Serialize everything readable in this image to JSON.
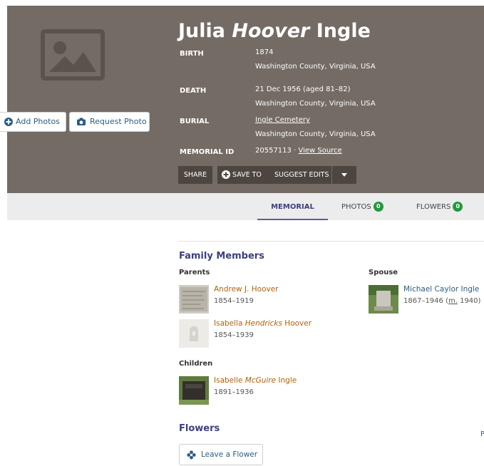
{
  "memorial": {
    "first_name": "Julia",
    "middle_name": "Hoover",
    "last_name": "Ingle",
    "birth_label": "BIRTH",
    "birth_date": "1874",
    "birth_place": "Washington County, Virginia, USA",
    "death_label": "DEATH",
    "death_date": "21 Dec 1956 (aged 81–82)",
    "death_place": "Washington County, Virginia, USA",
    "burial_label": "BURIAL",
    "burial_cemetery": "Ingle Cemetery",
    "burial_place": "Washington County, Virginia, USA",
    "memorial_id_label": "MEMORIAL ID",
    "memorial_id": "20557113",
    "id_sep": " · ",
    "view_source": "View Source"
  },
  "photo_buttons": {
    "add": "Add Photos",
    "request": "Request Photo"
  },
  "actions": {
    "share": "SHARE",
    "save_to": "SAVE TO",
    "suggest_edits": "SUGGEST EDITS"
  },
  "tabs": [
    {
      "label": "MEMORIAL"
    },
    {
      "label": "PHOTOS",
      "count": "0"
    },
    {
      "label": "FLOWERS",
      "count": "0"
    }
  ],
  "family": {
    "title": "Family Members",
    "parents_label": "Parents",
    "spouse_label": "Spouse",
    "children_label": "Children",
    "parents": [
      {
        "first": "Andrew J. Hoover",
        "dates": "1854–1919"
      },
      {
        "first": "Isabella ",
        "middle": "Hendricks",
        "last": " Hoover",
        "dates": "1854–1939"
      }
    ],
    "spouse": {
      "name": "Michael Caylor Ingle",
      "dates_pre": "1867–1946 (",
      "m": "m.",
      "dates_post": " 1940)"
    },
    "children": [
      {
        "first": "Isabelle ",
        "middle": "McGuire",
        "last": " Ingle",
        "dates": "1891–1936"
      }
    ]
  },
  "flowers": {
    "title": "Flowers",
    "leave_label": "Leave a Flower",
    "edge_text": "P"
  },
  "colors": {
    "header_bg": "#736b64",
    "accent": "#3c3f7e",
    "link_orange": "#b5600a",
    "link_blue": "#2a5d84",
    "badge_green": "#1f9a3b"
  }
}
